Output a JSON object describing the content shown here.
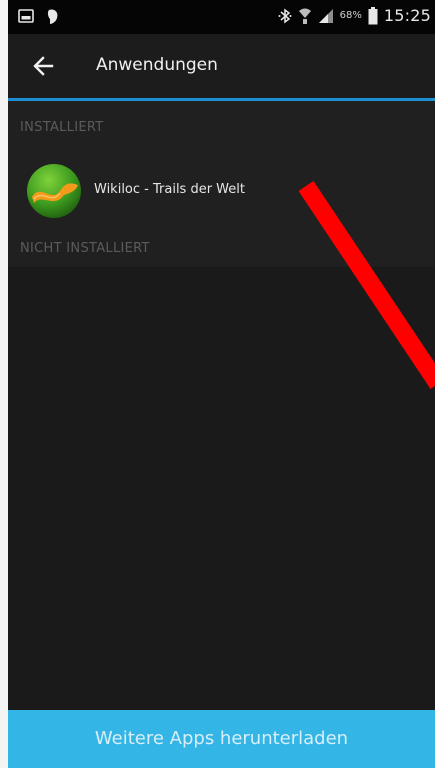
{
  "status_bar": {
    "battery_percent": "68%",
    "time": "15:25",
    "icons": [
      "gallery-icon",
      "notification-icon",
      "bluetooth-icon",
      "wifi-icon",
      "signal-icon",
      "battery-icon"
    ]
  },
  "app_bar": {
    "title": "Anwendungen",
    "back_icon": "arrow-left-icon"
  },
  "sections": {
    "installed_header": "INSTALLIERT",
    "not_installed_header": "NICHT INSTALLIERT"
  },
  "installed_apps": [
    {
      "name": "Wikiloc - Trails der Welt",
      "icon": "wikiloc-logo-icon"
    }
  ],
  "bottom_button": {
    "label": "Weitere Apps herunterladen"
  },
  "colors": {
    "accent": "#1e8fd0",
    "button": "#33b5e5",
    "annotation": "#ff0000"
  }
}
